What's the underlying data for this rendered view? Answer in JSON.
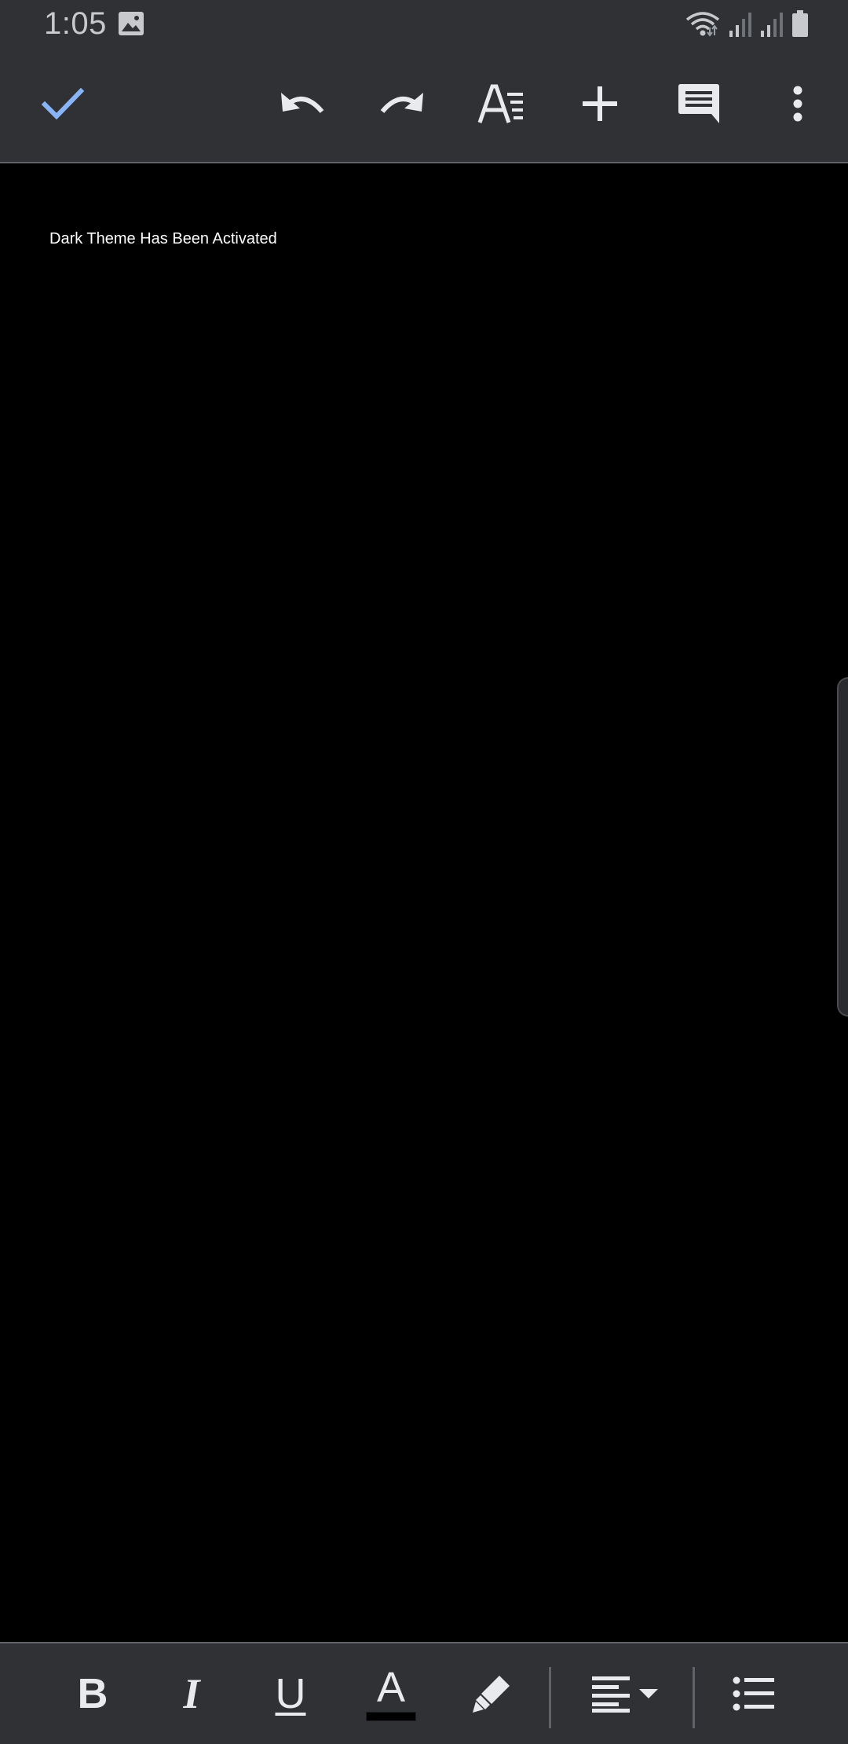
{
  "status_bar": {
    "time": "1:05",
    "icons": [
      "gallery-icon",
      "wifi-icon",
      "signal-icon",
      "signal-icon",
      "battery-icon"
    ]
  },
  "toolbar": {
    "buttons": [
      {
        "name": "done-button",
        "icon": "check-icon"
      },
      {
        "name": "undo-button",
        "icon": "undo-icon"
      },
      {
        "name": "redo-button",
        "icon": "redo-icon"
      },
      {
        "name": "text-format-button",
        "icon": "text-format-icon"
      },
      {
        "name": "insert-button",
        "icon": "plus-icon"
      },
      {
        "name": "comment-button",
        "icon": "comment-icon"
      },
      {
        "name": "more-options-button",
        "icon": "more-vert-icon"
      }
    ],
    "accent_color": "#8ab4f8"
  },
  "document": {
    "body_text": "Dark Theme Has Been Activated",
    "background": "#000000"
  },
  "format_bar": {
    "bold_label": "B",
    "italic_label": "I",
    "underline_label": "U",
    "text_color_label": "A",
    "text_color_swatch": "#000000",
    "buttons": [
      {
        "name": "bold-button",
        "icon": "bold-icon"
      },
      {
        "name": "italic-button",
        "icon": "italic-icon"
      },
      {
        "name": "underline-button",
        "icon": "underline-icon"
      },
      {
        "name": "text-color-button",
        "icon": "text-color-icon"
      },
      {
        "name": "highlight-button",
        "icon": "highlighter-icon"
      },
      {
        "name": "align-button",
        "icon": "align-left-icon"
      },
      {
        "name": "bulleted-list-button",
        "icon": "bulleted-list-icon"
      }
    ]
  }
}
